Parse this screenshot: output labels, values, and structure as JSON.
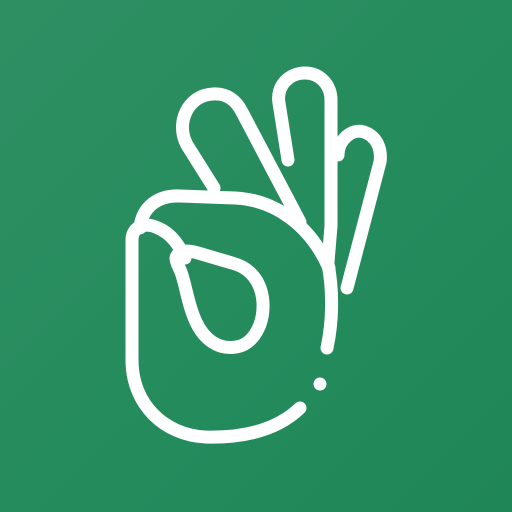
{
  "icon": {
    "name": "ok-hand-gesture-icon",
    "background_color": "#238b5c",
    "background_color_light": "#2e8f63",
    "stroke_color": "#ffffff"
  }
}
